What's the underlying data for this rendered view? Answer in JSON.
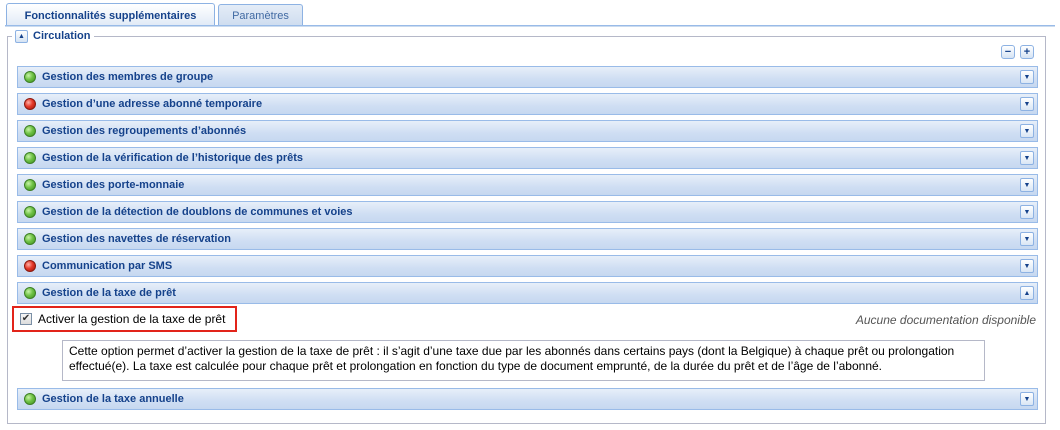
{
  "tabs": [
    {
      "label": "Fonctionnalités supplémentaires",
      "active": true
    },
    {
      "label": "Paramètres",
      "active": false
    }
  ],
  "section": {
    "title": "Circulation",
    "toggle_icon": "collapse-up-icon",
    "tools": {
      "collapse_all": "−",
      "expand_all": "+"
    }
  },
  "rows": [
    {
      "label": "Gestion des membres de groupe",
      "status": "green",
      "expanded": false
    },
    {
      "label": "Gestion d’une adresse abonné temporaire",
      "status": "red",
      "expanded": false
    },
    {
      "label": "Gestion des regroupements d’abonnés",
      "status": "green",
      "expanded": false
    },
    {
      "label": "Gestion de la vérification de l’historique des prêts",
      "status": "green",
      "expanded": false
    },
    {
      "label": "Gestion des porte-monnaie",
      "status": "green",
      "expanded": false
    },
    {
      "label": "Gestion de la détection de doublons de communes et voies",
      "status": "green",
      "expanded": false
    },
    {
      "label": "Gestion des navettes de réservation",
      "status": "green",
      "expanded": false
    },
    {
      "label": "Communication par SMS",
      "status": "red",
      "expanded": false
    },
    {
      "label": "Gestion de la taxe de prêt",
      "status": "green",
      "expanded": true
    },
    {
      "label": "Gestion de la taxe annuelle",
      "status": "green",
      "expanded": false
    }
  ],
  "expanded_panel": {
    "checkbox_label": "Activer la gestion de la taxe de prêt",
    "checked": true,
    "no_doc": "Aucune documentation disponible",
    "description": "Cette option permet d’activer la gestion de la taxe de prêt : il s’agit d’une taxe due par les abonnés dans certains pays (dont la Belgique) à chaque prêt ou prolongation effectué(e). La taxe est calculée pour chaque prêt et prolongation en fonction du type de document emprunté, de la durée du prêt et de l’âge de l’abonné."
  },
  "colors": {
    "status_green": "#6fc246",
    "status_red": "#e5392a",
    "highlight": "#e2241a"
  }
}
